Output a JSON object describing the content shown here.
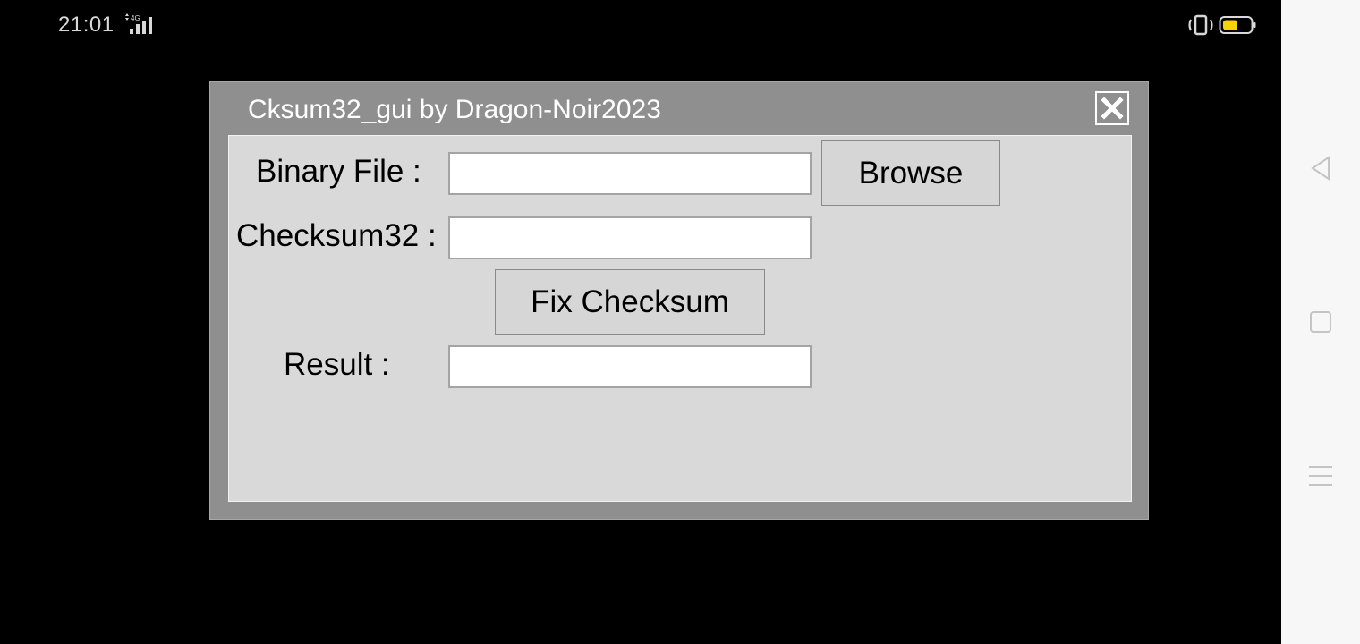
{
  "status_bar": {
    "time": "21:01",
    "network": "4G",
    "icons": [
      "signal-icon",
      "vibrate-icon",
      "battery-icon"
    ],
    "battery_color": "#f5d400"
  },
  "dialog": {
    "title": "Cksum32_gui by Dragon-Noir2023",
    "close_icon": "close-icon",
    "binary_file_label": "Binary File :",
    "binary_file_value": "",
    "browse_label": "Browse",
    "checksum_label": "Checksum32 :",
    "checksum_value": "",
    "fix_label": "Fix Checksum",
    "result_label": "Result :",
    "result_value": ""
  },
  "nav_bar": {
    "icons": [
      "back-icon",
      "home-icon",
      "menu-icon"
    ]
  },
  "colors": {
    "title_bar": "#8f8f8f",
    "panel": "#d9d9d9",
    "input_bg": "#ffffff",
    "button_bg": "#d6d6d6"
  }
}
